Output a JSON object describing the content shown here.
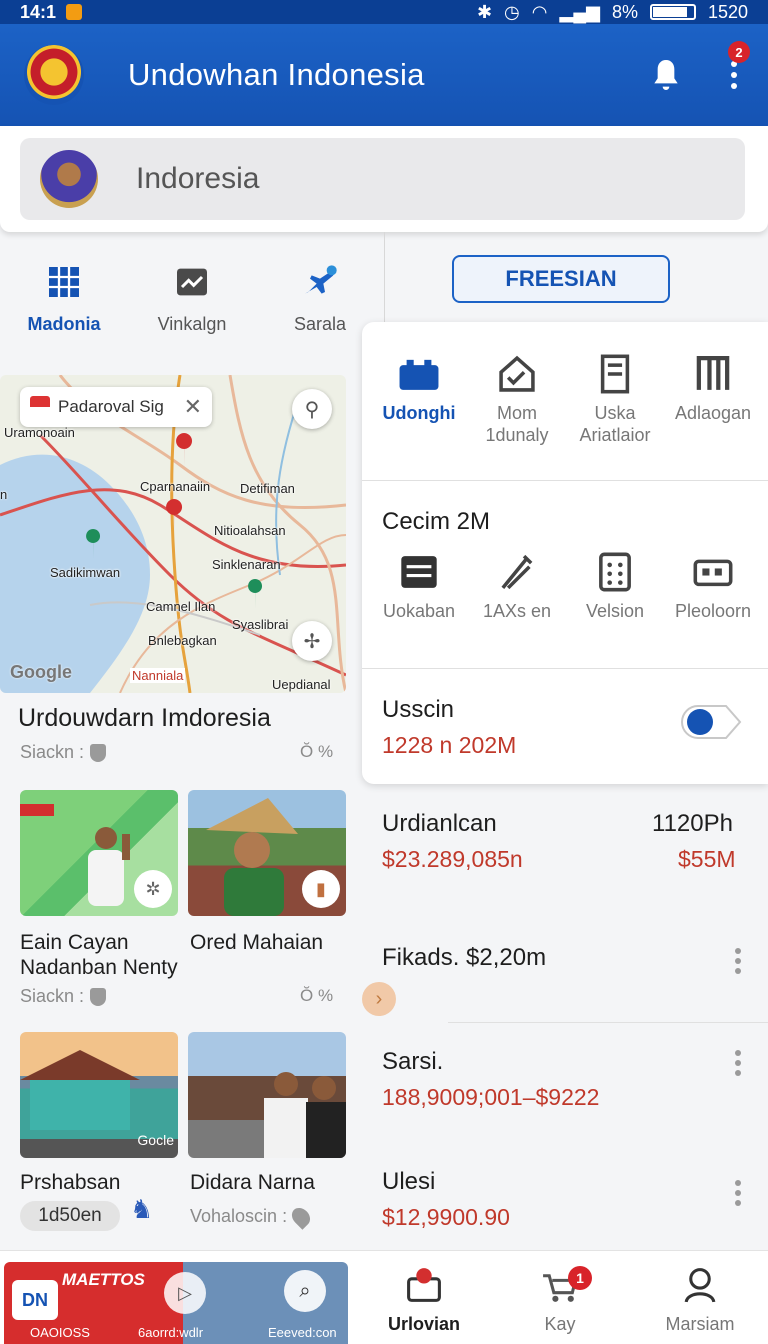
{
  "status": {
    "time": "14:1",
    "battery": "8%",
    "battery_level": 0.8,
    "clock": "1520"
  },
  "app": {
    "title": "Undowhan Indonesia",
    "menu_badge": "2"
  },
  "search": {
    "value": "Indoresia"
  },
  "quick_tabs": [
    {
      "label": "Madonia",
      "icon": "grid-icon"
    },
    {
      "label": "Vinkalgn",
      "icon": "chart-icon"
    },
    {
      "label": "Sarala",
      "icon": "plane-icon"
    }
  ],
  "free_button": "FREESIAN",
  "map": {
    "pill_text": "Padaroval Sig",
    "labels": [
      "Uramonoain",
      "Cparnanaiin",
      "Detifiman",
      "Nitioalahsan",
      "Sadikimwan",
      "Sinklenaran",
      "Camnel Ilan",
      "Syaslibrai",
      "Bnlebagkan",
      "Uepdianal",
      "n"
    ],
    "google": "Google",
    "red_label": "Nanniala"
  },
  "left_list": {
    "title": "Urdouwdarn Imdoresia",
    "meta1": "Siackn :",
    "meta1_right": "Ŏ %",
    "card1_title_a": "Eain Cayan",
    "card1_title_b": "Nadanban Nenty",
    "card2_title": "Ored Mahaian",
    "meta2": "Siackn :",
    "meta2_right": "Ŏ %",
    "card3_title": "Prshabsan",
    "card3_chip": "1d50en",
    "card4_title": "Didara Narna",
    "card4_meta": "Vohaloscin :",
    "watermark": "Gocle"
  },
  "right_panel": {
    "row1": [
      {
        "label": "Udonghi",
        "icon": "battery-icon"
      },
      {
        "label": "Mom 1dunaly",
        "icon": "check-home-icon"
      },
      {
        "label": "Uska Ariatlaior",
        "icon": "document-icon"
      },
      {
        "label": "Adlaogan",
        "icon": "columns-icon"
      }
    ],
    "section_title": "Cecim 2M",
    "row2": [
      {
        "label": "Uokaban",
        "icon": "list-icon"
      },
      {
        "label": "1AXs en",
        "icon": "tools-icon"
      },
      {
        "label": "Velsion",
        "icon": "keypad-icon"
      },
      {
        "label": "Pleoloorn",
        "icon": "bus-icon"
      }
    ],
    "toggle_title": "Usscin",
    "toggle_value": "1228 n 202M"
  },
  "finance": [
    {
      "title": "Urdianlcan",
      "right": "1120Ph",
      "value": "$23.289,085n",
      "right_value": "$55M"
    },
    {
      "title": "Fikads. $2,20m"
    },
    {
      "title": "Sarsi.",
      "value": "188,9009;001–$9222"
    },
    {
      "title": "Ulesi",
      "value": "$12,9900.90"
    }
  ],
  "banner": {
    "title": "MAETTOS",
    "logo": "DN",
    "sub1": "OAOIOSS",
    "sub2": "6aorrd:wdlr",
    "sub3": "Eeeved:con"
  },
  "bottom_nav": [
    {
      "label": "Urlovian",
      "icon": "inbox-icon"
    },
    {
      "label": "Kay",
      "icon": "cart-icon",
      "badge": "1"
    },
    {
      "label": "Marsiam",
      "icon": "profile-icon"
    }
  ],
  "colors": {
    "brand": "#1553b3",
    "accent_red": "#c0392b",
    "badge_red": "#d8232a"
  }
}
